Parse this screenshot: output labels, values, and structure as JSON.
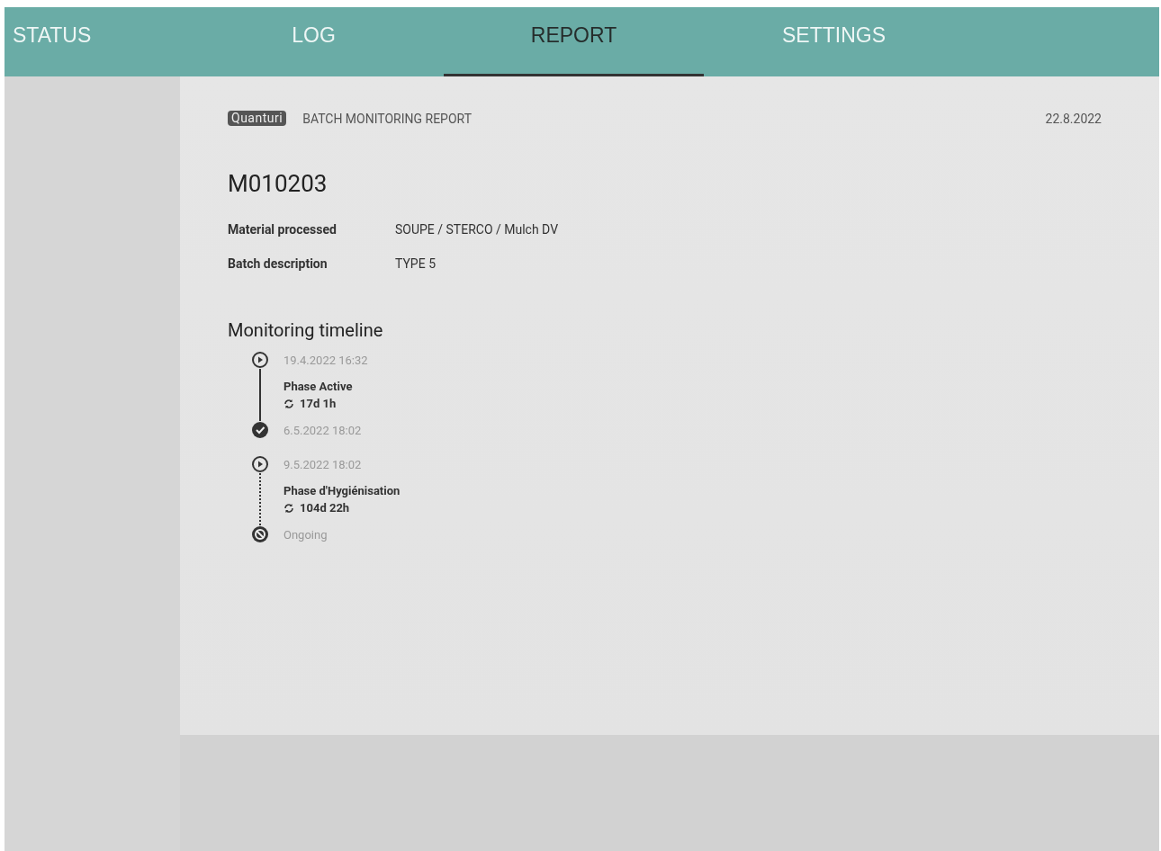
{
  "tabs": [
    {
      "label": "STATUS",
      "selected": false
    },
    {
      "label": "LOG",
      "selected": false
    },
    {
      "label": "REPORT",
      "selected": true
    },
    {
      "label": "SETTINGS",
      "selected": false
    }
  ],
  "report": {
    "logo": "Quanturi",
    "heading": "BATCH MONITORING REPORT",
    "date": "22.8.2022",
    "batch_id": "M010203",
    "details": [
      {
        "label": "Material processed",
        "value": "SOUPE / STERCO / Mulch DV"
      },
      {
        "label": "Batch description",
        "value": "TYPE 5"
      }
    ],
    "timeline_title": "Monitoring timeline",
    "phases": [
      {
        "start": "19.4.2022 16:32",
        "name": "Phase Active",
        "duration": "17d 1h",
        "end": "6.5.2022 18:02",
        "completed": true
      },
      {
        "start": "9.5.2022 18:02",
        "name": "Phase d'Hygiénisation",
        "duration": "104d 22h",
        "end": "Ongoing",
        "completed": false
      }
    ]
  }
}
